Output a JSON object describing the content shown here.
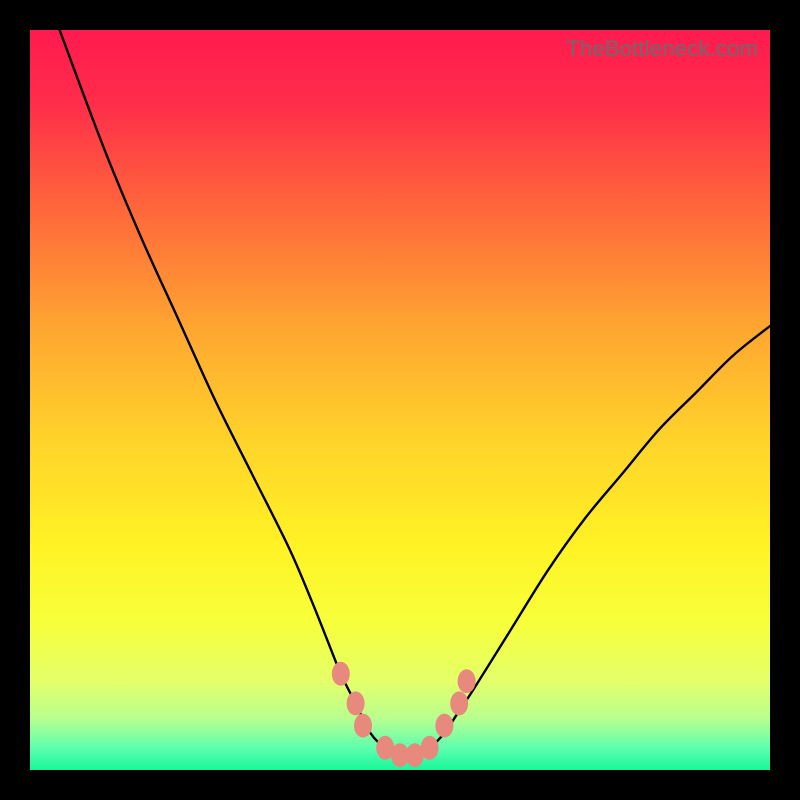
{
  "watermark": "TheBottleneck.com",
  "chart_data": {
    "type": "line",
    "title": "",
    "xlabel": "",
    "ylabel": "",
    "xlim": [
      0,
      100
    ],
    "ylim": [
      0,
      100
    ],
    "grid": false,
    "legend": null,
    "series": [
      {
        "name": "bottleneck-curve",
        "color": "#000000",
        "x": [
          4,
          10,
          15,
          20,
          25,
          30,
          35,
          38,
          40,
          42,
          44,
          46,
          48,
          50,
          52,
          54,
          56,
          58,
          60,
          65,
          70,
          75,
          80,
          85,
          90,
          95,
          100
        ],
        "y": [
          100,
          84,
          72,
          61,
          50,
          40,
          30,
          23,
          18,
          13,
          9,
          5,
          3,
          2,
          2,
          3,
          5,
          8,
          11,
          19,
          27,
          34,
          40,
          46,
          51,
          56,
          60
        ]
      }
    ],
    "markers": {
      "name": "highlight-points",
      "color": "#e78a7d",
      "points": [
        {
          "x": 42,
          "y": 13
        },
        {
          "x": 44,
          "y": 9
        },
        {
          "x": 45,
          "y": 6
        },
        {
          "x": 48,
          "y": 3
        },
        {
          "x": 50,
          "y": 2
        },
        {
          "x": 52,
          "y": 2
        },
        {
          "x": 54,
          "y": 3
        },
        {
          "x": 56,
          "y": 6
        },
        {
          "x": 58,
          "y": 9
        },
        {
          "x": 59,
          "y": 12
        }
      ]
    },
    "background_gradient": {
      "stops": [
        {
          "offset": 0.0,
          "color": "#ff1a4f"
        },
        {
          "offset": 0.1,
          "color": "#ff2d4a"
        },
        {
          "offset": 0.25,
          "color": "#ff6a3a"
        },
        {
          "offset": 0.4,
          "color": "#ffa531"
        },
        {
          "offset": 0.55,
          "color": "#ffd22a"
        },
        {
          "offset": 0.7,
          "color": "#fff325"
        },
        {
          "offset": 0.8,
          "color": "#f7ff3a"
        },
        {
          "offset": 0.88,
          "color": "#e4ff6a"
        },
        {
          "offset": 0.93,
          "color": "#b8ff8f"
        },
        {
          "offset": 0.97,
          "color": "#5fffaf"
        },
        {
          "offset": 1.0,
          "color": "#17f79a"
        }
      ]
    }
  }
}
